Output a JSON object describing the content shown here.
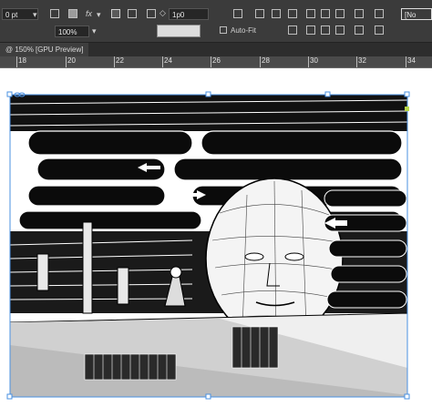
{
  "control_bar": {
    "stroke_weight": "0 pt",
    "scale": "100%",
    "spacing": "1p0",
    "fx_label": "fx",
    "auto_fit_label": "Auto-Fit",
    "corner_label": "[No"
  },
  "document_tab": {
    "label": "@ 150% [GPU Preview]"
  },
  "ruler": {
    "labels": [
      "18",
      "20",
      "22",
      "24",
      "26",
      "28",
      "30",
      "32",
      "34"
    ]
  },
  "colors": {
    "toolbar_bg": "#3b3b3b",
    "frame_selection": "#4a90e2",
    "canvas_bg": "#ffffff"
  },
  "artwork": {
    "description_icon": "comic-illustration-image"
  }
}
